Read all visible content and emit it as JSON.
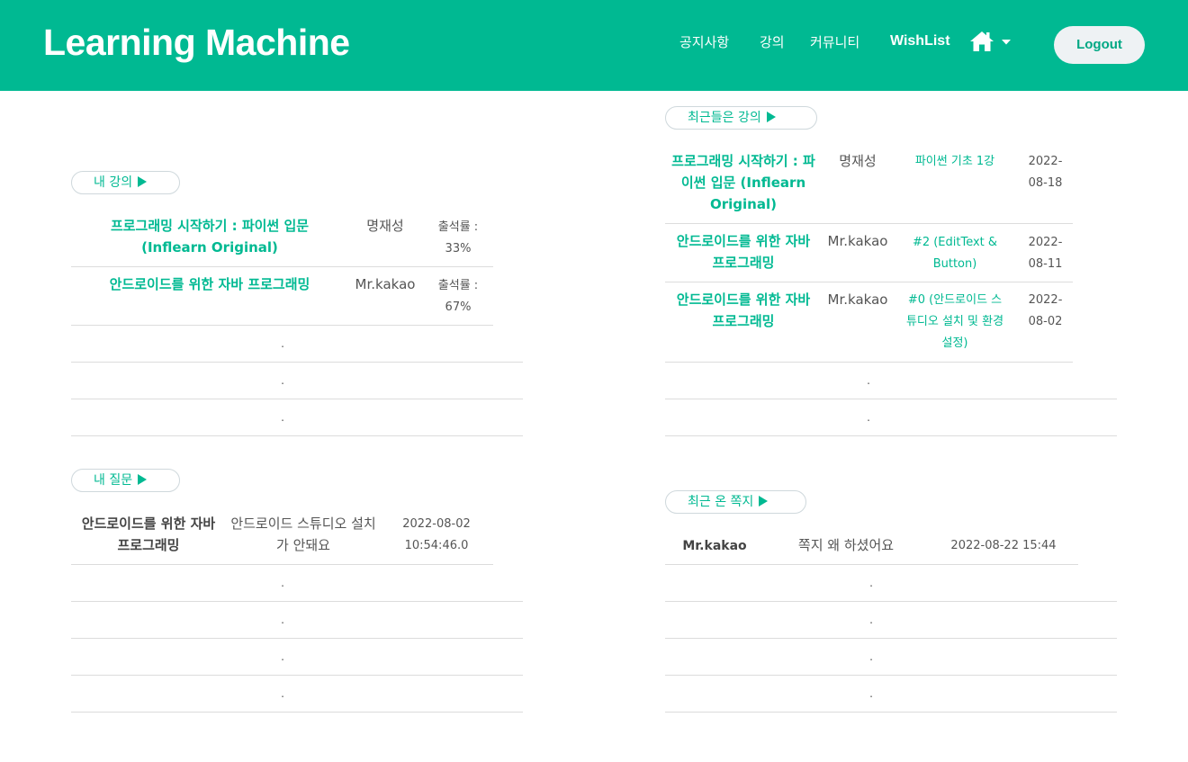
{
  "brand": "Learning Machine",
  "nav": {
    "notice": "공지사항",
    "lecture": "강의",
    "community": "커뮤니티",
    "wishlist": "WishList",
    "logout": "Logout"
  },
  "my_lectures": {
    "title": "내 강의",
    "rows": [
      {
        "course": "프로그래밍 시작하기 : 파이썬 입문 (Inflearn Original)",
        "instructor": "명재성",
        "attendance_label": "출석률 :",
        "attendance_value": "33%"
      },
      {
        "course": "안드로이드를 위한 자바 프로그래밍",
        "instructor": "Mr.kakao",
        "attendance_label": "출석률 :",
        "attendance_value": "67%"
      }
    ],
    "placeholder_rows": [
      ".",
      ".",
      "."
    ]
  },
  "recent_lectures": {
    "title": "최근들은 강의",
    "rows": [
      {
        "course": "프로그래밍 시작하기 : 파이썬 입문 (Inflearn Original)",
        "instructor": "명재성",
        "lesson": "파이썬 기초 1강",
        "date": "2022-08-18"
      },
      {
        "course": "안드로이드를 위한 자바 프로그래밍",
        "instructor": "Mr.kakao",
        "lesson": "#2 (EditText & Button)",
        "date": "2022-08-11"
      },
      {
        "course": "안드로이드를 위한 자바 프로그래밍",
        "instructor": "Mr.kakao",
        "lesson": "#0 (안드로이드 스튜디오 설치 및 환경설정)",
        "date": "2022-08-02"
      }
    ],
    "placeholder_rows": [
      ".",
      "."
    ]
  },
  "my_questions": {
    "title": "내 질문",
    "rows": [
      {
        "course": "안드로이드를 위한 자바 프로그래밍",
        "question": "안드로이드 스튜디오 설치가 안돼요",
        "datetime": "2022-08-02 10:54:46.0"
      }
    ],
    "placeholder_rows": [
      ".",
      ".",
      ".",
      "."
    ]
  },
  "recent_messages": {
    "title": "최근 온 쪽지",
    "rows": [
      {
        "sender": "Mr.kakao",
        "message": "쪽지 왜 하셨어요",
        "datetime": "2022-08-22 15:44"
      }
    ],
    "placeholder_rows": [
      ".",
      ".",
      ".",
      "."
    ]
  },
  "colors": {
    "primary": "#00b992",
    "logout_bg": "#eef2f4",
    "text": "#555555"
  },
  "icons": [
    "home-icon",
    "caret-down-icon",
    "play-triangle-icon"
  ]
}
